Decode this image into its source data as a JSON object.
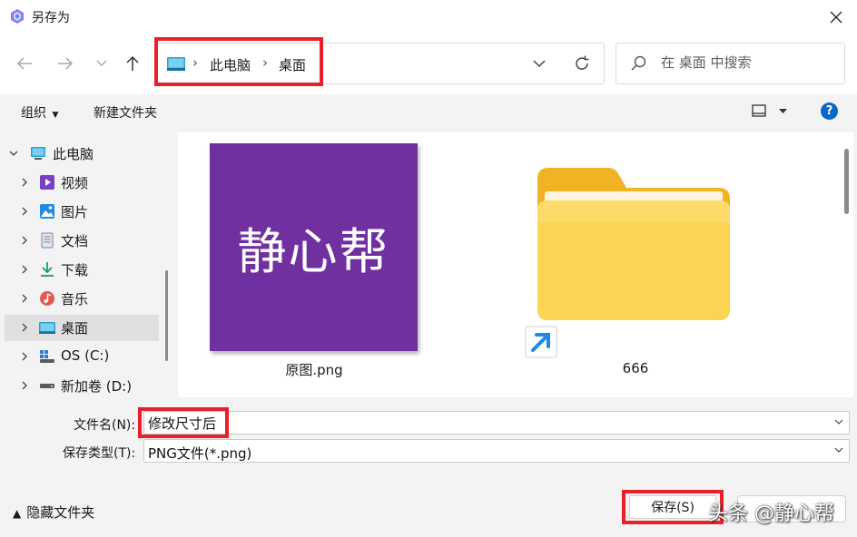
{
  "window": {
    "title": "另存为"
  },
  "nav": {
    "breadcrumb": [
      "此电脑",
      "桌面"
    ],
    "search_placeholder": "在 桌面 中搜索"
  },
  "toolbar": {
    "organize": "组织",
    "new_folder": "新建文件夹",
    "help": "?"
  },
  "sidebar": {
    "items": [
      {
        "label": "此电脑"
      },
      {
        "label": "视频"
      },
      {
        "label": "图片"
      },
      {
        "label": "文档"
      },
      {
        "label": "下载"
      },
      {
        "label": "音乐"
      },
      {
        "label": "桌面"
      },
      {
        "label": "OS (C:)"
      },
      {
        "label": "新加卷 (D:)"
      }
    ],
    "selected": "桌面"
  },
  "files": [
    {
      "name": "原图.png",
      "thumbnail_text": "静心帮"
    },
    {
      "name": "666"
    }
  ],
  "form": {
    "filename_label": "文件名(N):",
    "filename_value": "修改尺寸后",
    "filetype_label": "保存类型(T):",
    "filetype_value": "PNG文件(*.png)"
  },
  "footer": {
    "hide_folders": "隐藏文件夹",
    "save": "保存(S)",
    "watermark": "头条 @静心帮"
  },
  "colors": {
    "highlight": "#e8202a",
    "thumb_bg": "#7030a0",
    "folder": "#f8c53c",
    "accent": "#0a66c8"
  }
}
